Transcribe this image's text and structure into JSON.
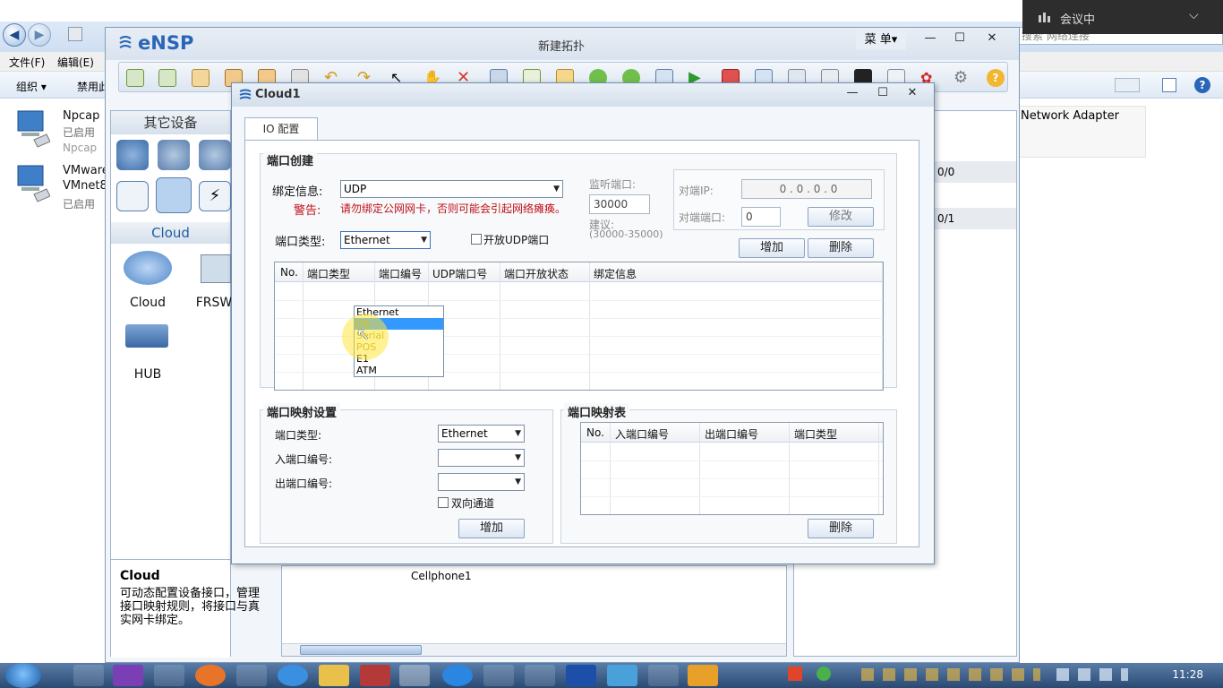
{
  "explorer": {
    "menu": [
      "文件(F)",
      "编辑(E)"
    ],
    "toolbar": [
      "组织 ▾",
      "禁用此"
    ],
    "adapters": [
      {
        "name": "Npcap",
        "status": "已启用",
        "sub": "Npcap"
      },
      {
        "name": "VMware",
        "name2": "VMnet8",
        "status": "已启用"
      }
    ],
    "right_adapter": "Network Adapter",
    "search_placeholder": "搜索 网络连接"
  },
  "meeting": {
    "label": "会议中"
  },
  "ensp": {
    "logo": "eNSP",
    "title": "新建拓扑",
    "menu_label": "菜 单▾",
    "left_panel": {
      "header_other": "其它设备",
      "header_cloud": "Cloud",
      "devices": [
        "Cloud",
        "FRSW",
        "HUB"
      ],
      "desc_title": "Cloud",
      "desc_text": "可动态配置设备接口，管理接口映射规则，将接口与真实网卡绑定。"
    },
    "canvas_label": "Cellphone1",
    "right_panel": {
      "rows": [
        "0/0",
        "0/1"
      ]
    }
  },
  "cloud": {
    "title": "Cloud1",
    "tab": "IO 配置",
    "port_create": {
      "legend": "端口创建",
      "bind_label": "绑定信息:",
      "bind_value": "UDP",
      "warn_label": "警告:",
      "warn_text": "请勿绑定公网网卡，否则可能会引起网络瘫痪。",
      "type_label": "端口类型:",
      "type_value": "Ethernet",
      "open_udp": "开放UDP端口",
      "listen_label": "监听端口:",
      "listen_value": "30000",
      "suggest_label": "建议:",
      "suggest_range": "(30000-35000)",
      "peer_ip_label": "对端IP:",
      "peer_ip_value": "0 . 0 . 0 . 0",
      "peer_port_label": "对端端口:",
      "peer_port_value": "0",
      "modify": "修改",
      "add": "增加",
      "delete": "删除",
      "columns": [
        "No.",
        "端口类型",
        "端口编号",
        "UDP端口号",
        "端口开放状态",
        "绑定信息"
      ],
      "dropdown": [
        "Ethernet",
        "GE",
        "Serial",
        "POS",
        "E1",
        "ATM"
      ],
      "dropdown_selected": "GE"
    },
    "port_map": {
      "legend": "端口映射设置",
      "type_label": "端口类型:",
      "type_value": "Ethernet",
      "in_label": "入端口编号:",
      "out_label": "出端口编号:",
      "bidir": "双向通道",
      "add": "增加"
    },
    "map_table": {
      "legend": "端口映射表",
      "columns": [
        "No.",
        "入端口编号",
        "出端口编号",
        "端口类型"
      ],
      "delete": "删除"
    }
  },
  "taskbar": {
    "clock": "11:28"
  }
}
